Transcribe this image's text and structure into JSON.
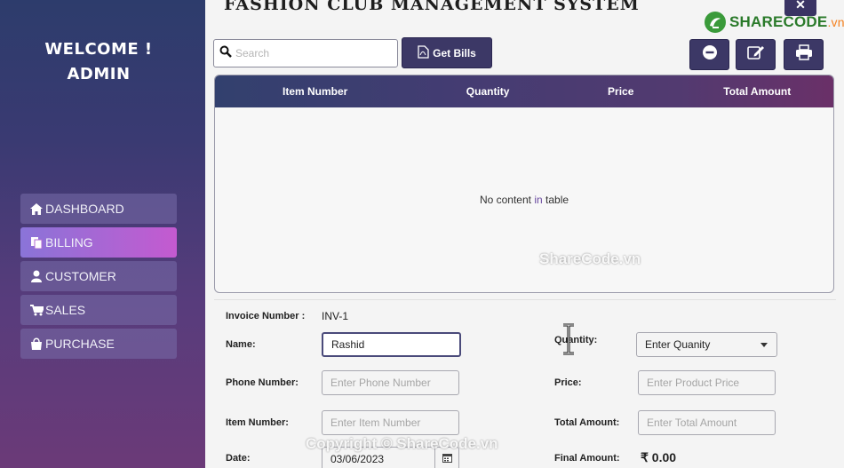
{
  "app": {
    "title": "FASHION CLUB MANAGEMENT SYSTEM",
    "close_label": "✕"
  },
  "sidebar": {
    "welcome_line1": "WELCOME !",
    "welcome_line2": "ADMIN",
    "items": [
      {
        "label": "DASHBOARD",
        "icon": "home-icon",
        "active": false
      },
      {
        "label": "BILLING",
        "icon": "copy-icon",
        "active": true
      },
      {
        "label": "CUSTOMER",
        "icon": "user-icon",
        "active": false
      },
      {
        "label": "SALES",
        "icon": "cart-icon",
        "active": false
      },
      {
        "label": "PURCHASE",
        "icon": "bag-icon",
        "active": false
      }
    ]
  },
  "toolbar": {
    "search_placeholder": "Search",
    "get_bills_label": "Get Bills",
    "actions": [
      "remove-icon",
      "edit-icon",
      "print-icon"
    ]
  },
  "table": {
    "columns": [
      "Item Number",
      "Quantity",
      "Price",
      "Total Amount"
    ],
    "empty_text_before": "No content ",
    "empty_text_in": "in",
    "empty_text_after": " table"
  },
  "form": {
    "invoice_label": "Invoice Number :",
    "invoice_value": "INV-1",
    "name_label": "Name:",
    "name_value": "Rashid",
    "phone_label": "Phone Number:",
    "phone_placeholder": "Enter Phone Number",
    "item_label": "Item Number:",
    "item_placeholder": "Enter Item Number",
    "date_label": "Date:",
    "date_value": "03/06/2023",
    "quantity_label": "Quantity:",
    "quantity_value": "Enter Quanity",
    "price_label": "Price:",
    "price_placeholder": "Enter Product Price",
    "total_label": "Total Amount:",
    "total_placeholder": "Enter Total Amount",
    "final_label": "Final Amount:",
    "final_value": "₹ 0.00"
  },
  "watermarks": {
    "logo_text_a": "SHARECODE",
    "logo_text_b": ".vn",
    "center": "ShareCode.vn",
    "bottom": "Copyright © ShareCode.vn"
  },
  "colors": {
    "accent": "#3c3866",
    "active_nav_start": "#8a74d8",
    "active_nav_end": "#c45ad0"
  }
}
